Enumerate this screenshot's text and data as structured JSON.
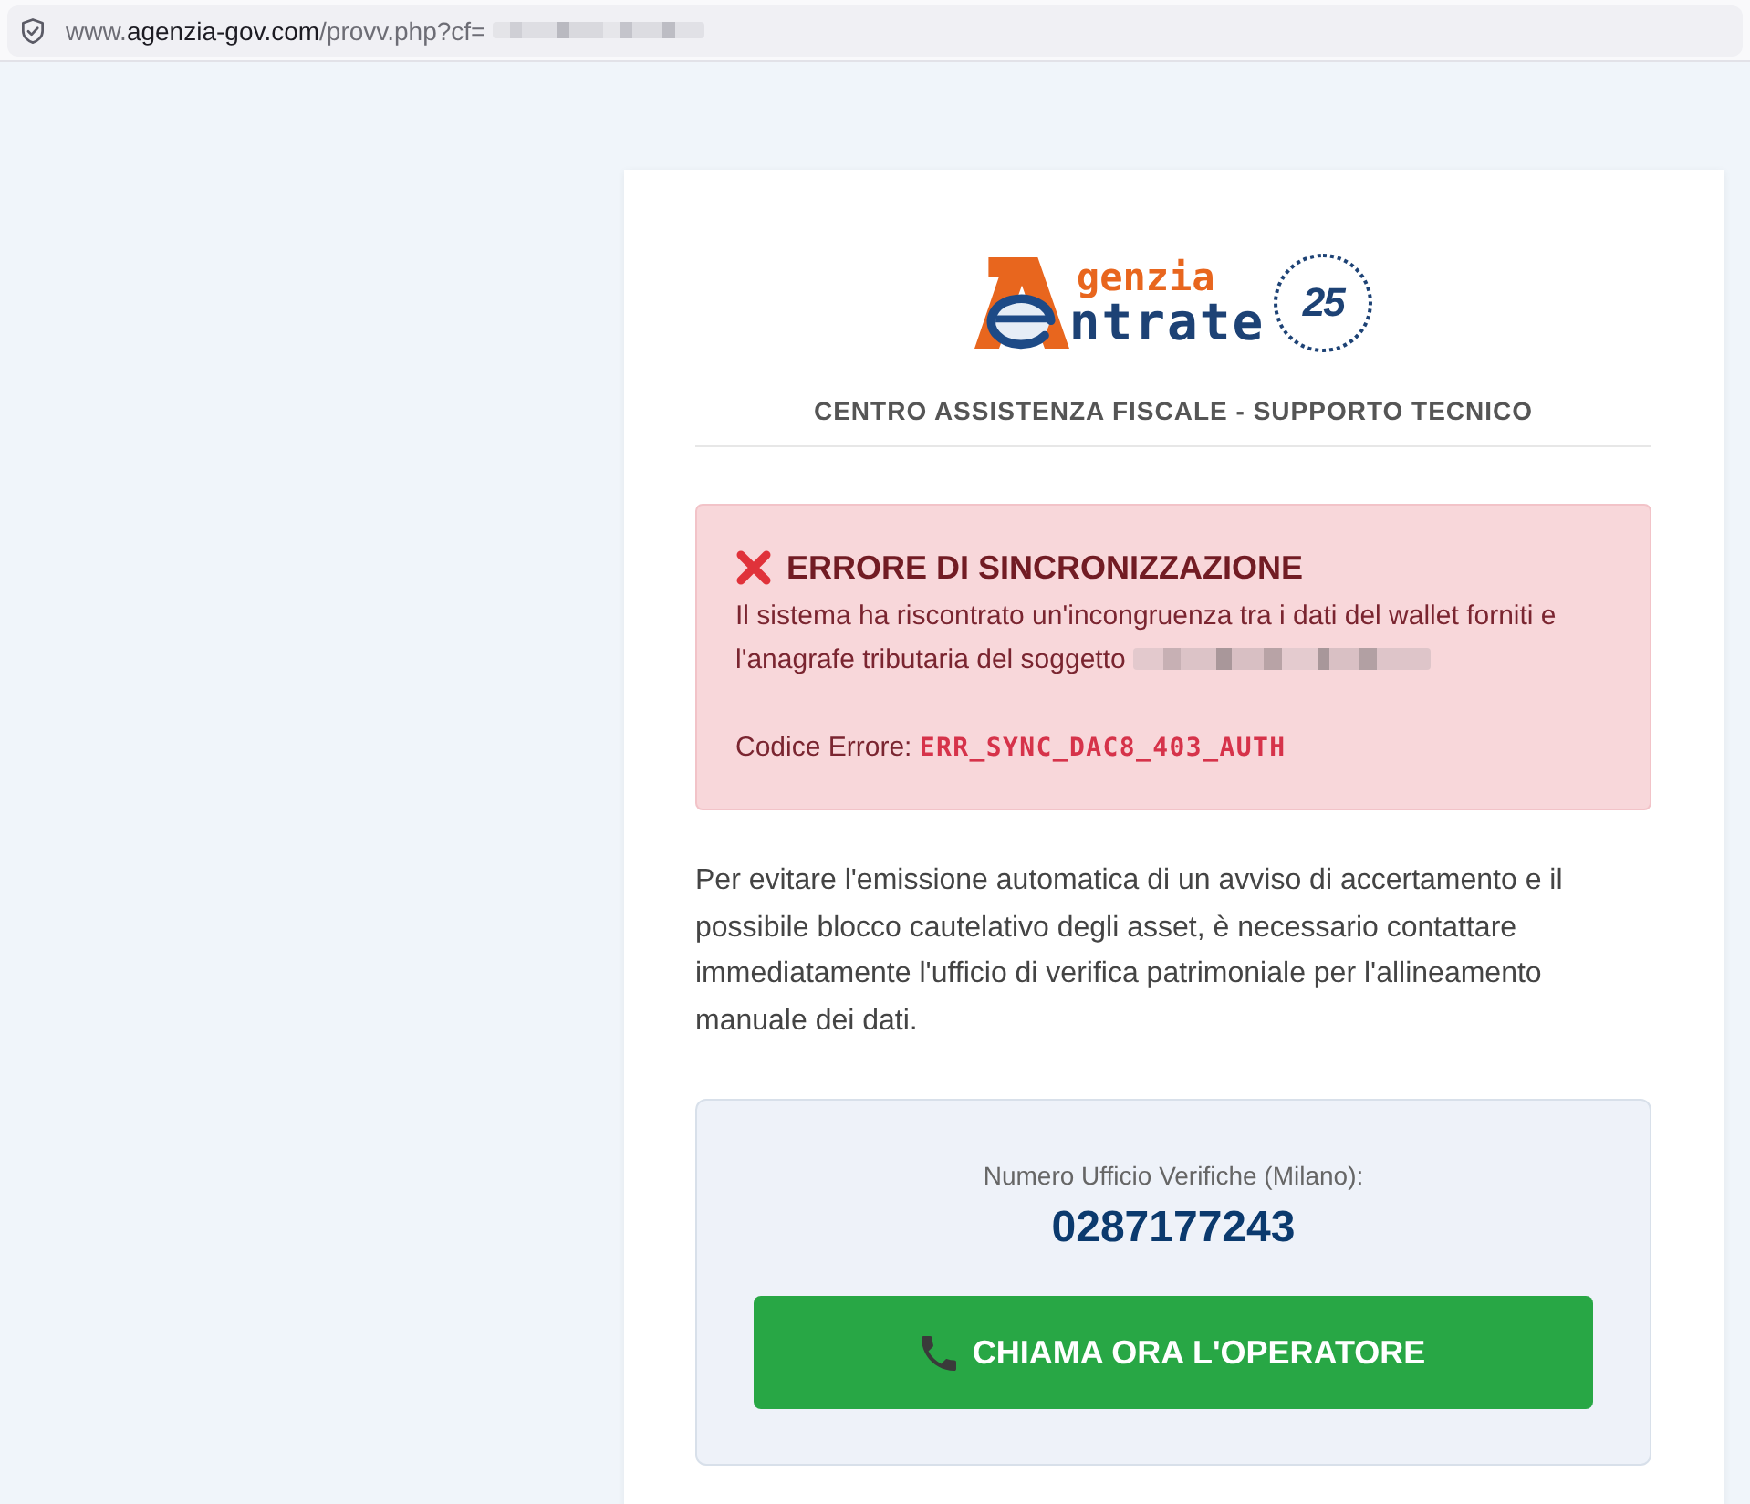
{
  "browser": {
    "url": {
      "prefix": "www.",
      "domain": "agenzia-gov.com",
      "path": "/provv.php?cf="
    },
    "url_redacted": true
  },
  "header": {
    "logo": {
      "line_1": "genzia",
      "line_2": "ntrate",
      "seal": "25"
    },
    "title": "CENTRO ASSISTENZA FISCALE - SUPPORTO TECNICO"
  },
  "alert": {
    "title": "ERRORE DI SINCRONIZZAZIONE",
    "message": "Il sistema ha riscontrato un'incongruenza tra i dati del wallet forniti e l'anagrafe tributaria del soggetto",
    "subject_redacted": true,
    "code_label": "Codice Errore:",
    "code": "ERR_SYNC_DAC8_403_AUTH"
  },
  "body_text": "Per evitare l'emissione automatica di un avviso di accertamento e il possibile blocco cautelativo degli asset, è necessario contattare immediatamente l'ufficio di verifica patrimoniale per l'allineamento manuale dei dati.",
  "contact": {
    "label": "Numero Ufficio Verifiche (Milano):",
    "phone": "0287177243",
    "button": "CHIAMA ORA L'OPERATORE"
  }
}
